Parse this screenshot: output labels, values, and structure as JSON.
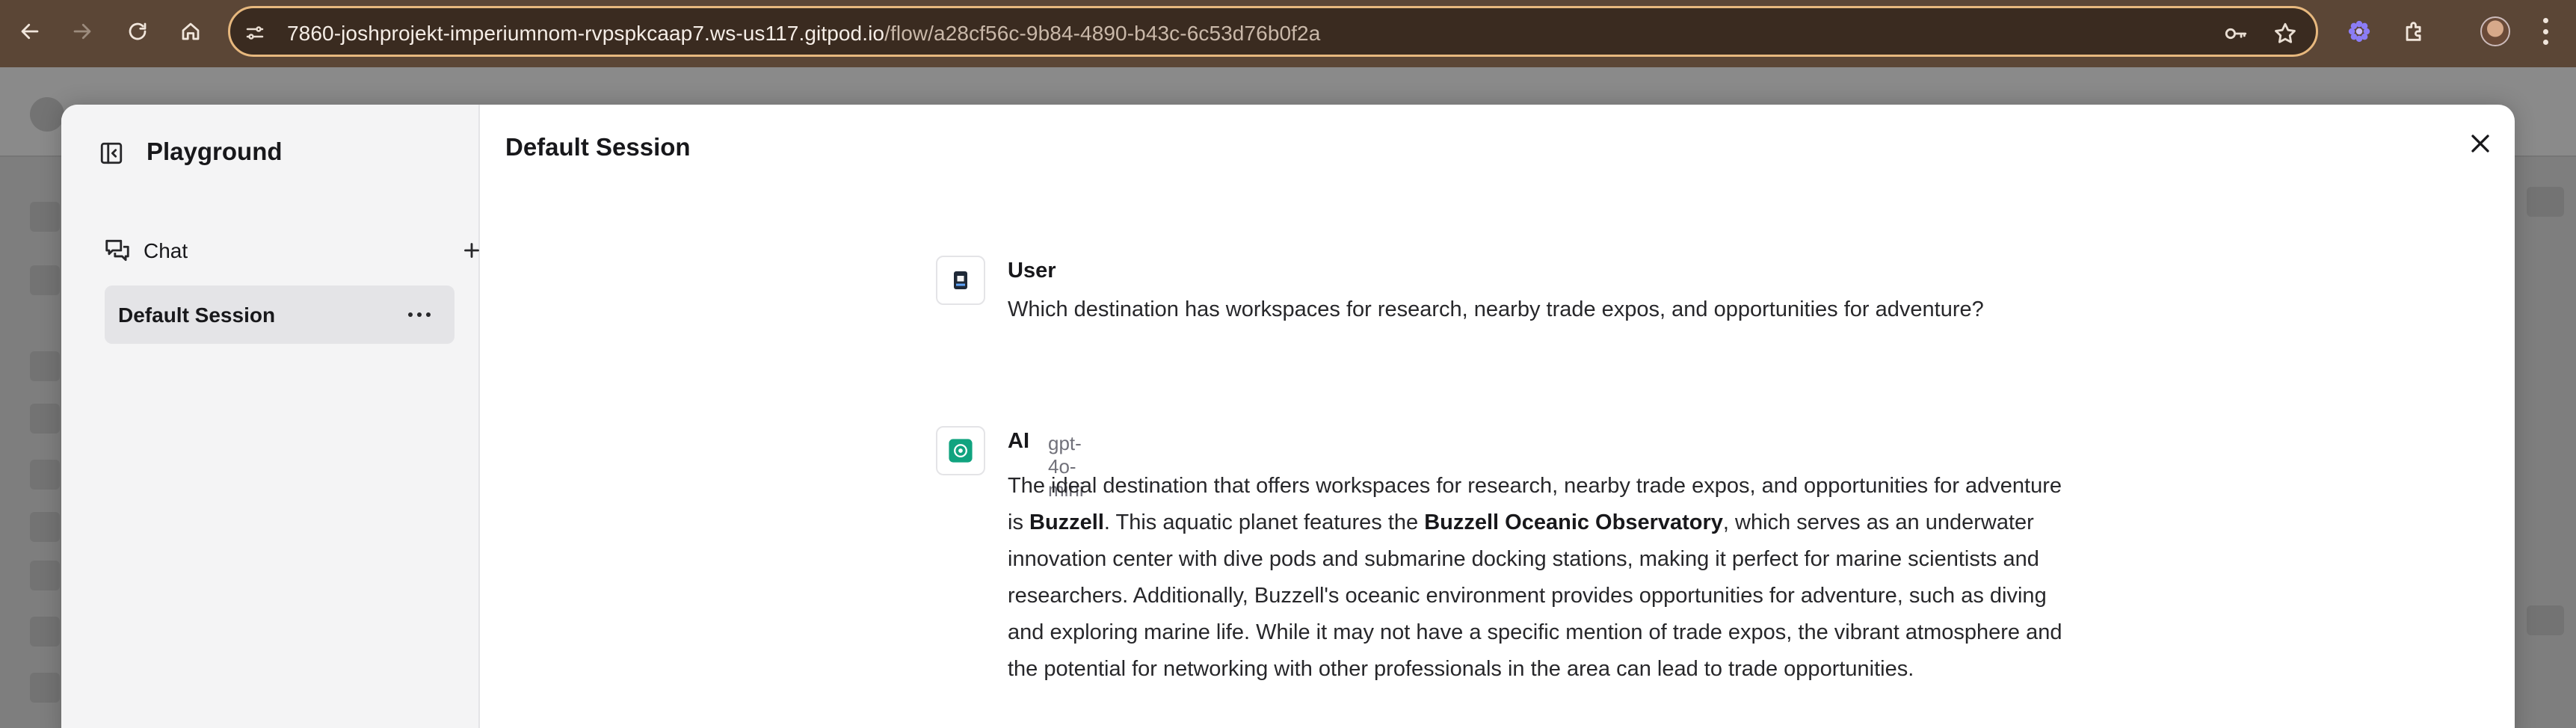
{
  "browser": {
    "url_host": "7860-joshprojekt-imperiumnom-rvpspkcaap7.ws-us117.gitpod.io",
    "url_path": "/flow/a28cf56c-9b84-4890-b43c-6c53d76b0f2a",
    "icons": [
      "back-icon",
      "forward-icon",
      "reload-icon",
      "home-icon",
      "site-info-icon",
      "password-key-icon",
      "bookmark-star-icon",
      "extension-flower-icon",
      "extensions-puzzle-icon",
      "profile-avatar",
      "menu-kebab-icon"
    ]
  },
  "sidebar": {
    "title": "Playground",
    "chat_label": "Chat",
    "sessions": [
      {
        "label": "Default Session"
      }
    ]
  },
  "main": {
    "title": "Default Session",
    "messages": [
      {
        "sender": "User",
        "text": "Which destination has workspaces for research, nearby trade expos, and opportunities for adventure?"
      },
      {
        "sender": "AI",
        "model": "gpt-4o-mini",
        "text_parts": [
          "The ideal destination that offers workspaces for research, nearby trade expos, and opportunities for adventure is ",
          "Buzzell",
          ". This aquatic planet features the ",
          "Buzzell Oceanic Observatory",
          ", which serves as an underwater innovation center with dive pods and submarine docking stations, making it perfect for marine scientists and researchers. Additionally, Buzzell's oceanic environment provides opportunities for adventure, such as diving and exploring marine life. While it may not have a specific mention of trade expos, the vibrant atmosphere and the potential for networking with other professionals in the area can lead to trade opportunities."
        ]
      }
    ]
  },
  "colors": {
    "chrome_bg": "#5b4636",
    "omnibox_border": "#e7b87e",
    "sidebar_bg": "#f4f4f5",
    "active_session_bg": "#e4e4e7",
    "ai_avatar": "#10a37f",
    "overlay_bg": "#7e7e7e"
  }
}
